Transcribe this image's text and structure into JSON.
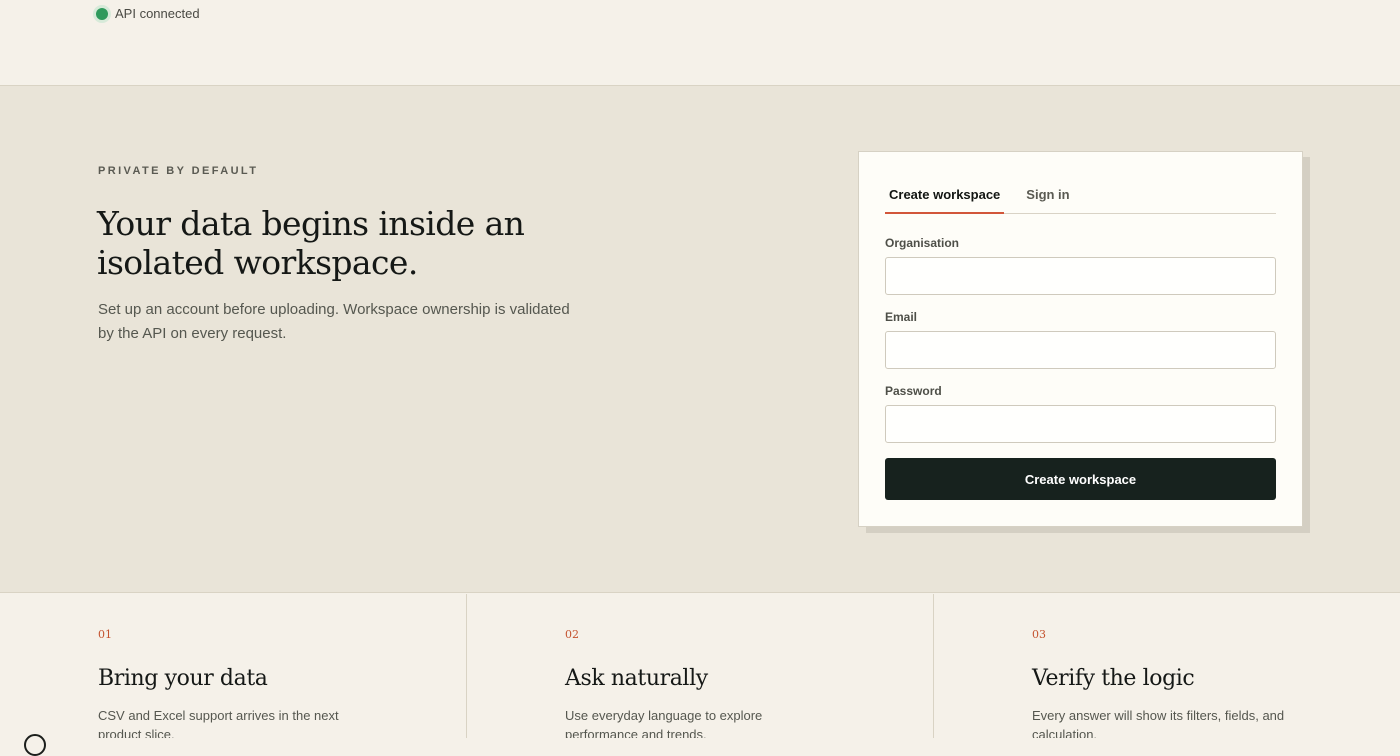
{
  "status": {
    "text": "API connected",
    "color": "#2f9a5c"
  },
  "hero": {
    "eyebrow": "PRIVATE BY DEFAULT",
    "title": "Your data begins inside an isolated workspace.",
    "subtitle": "Set up an account before uploading. Workspace ownership is validated by the API on every request."
  },
  "auth": {
    "tabs": [
      {
        "label": "Create workspace",
        "active": true
      },
      {
        "label": "Sign in",
        "active": false
      }
    ],
    "fields": {
      "organisation": {
        "label": "Organisation",
        "value": "",
        "placeholder": ""
      },
      "email": {
        "label": "Email",
        "value": "",
        "placeholder": ""
      },
      "password": {
        "label": "Password",
        "value": "",
        "placeholder": ""
      }
    },
    "submit_label": "Create workspace",
    "accent_color": "#d2563a",
    "button_color": "#17221e"
  },
  "features": [
    {
      "number": "01",
      "title": "Bring your data",
      "description": "CSV and Excel support arrives in the next product slice."
    },
    {
      "number": "02",
      "title": "Ask naturally",
      "description": "Use everyday language to explore performance and trends."
    },
    {
      "number": "03",
      "title": "Verify the logic",
      "description": "Every answer will show its filters, fields, and calculation."
    }
  ]
}
